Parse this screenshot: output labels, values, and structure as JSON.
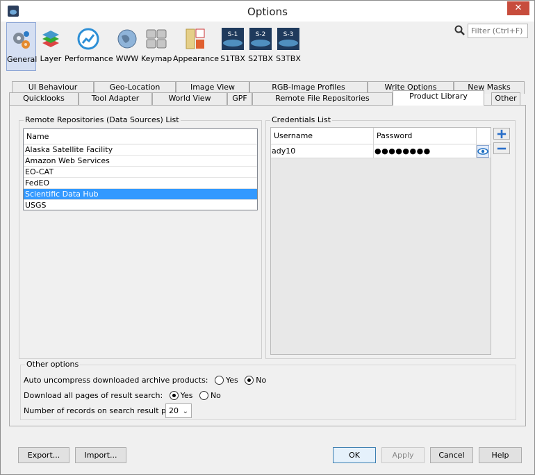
{
  "window": {
    "title": "Options",
    "close_glyph": "✕"
  },
  "toolbar": {
    "items": [
      {
        "label": "General",
        "icon": "gears-icon"
      },
      {
        "label": "Layer",
        "icon": "layers-icon"
      },
      {
        "label": "Performance",
        "icon": "performance-icon"
      },
      {
        "label": "WWW",
        "icon": "globe-icon"
      },
      {
        "label": "Keymap",
        "icon": "keyboard-icon"
      },
      {
        "label": "Appearance",
        "icon": "appearance-icon"
      },
      {
        "label": "S1TBX",
        "icon": "s1-icon",
        "badge": "S-1"
      },
      {
        "label": "S2TBX",
        "icon": "s2-icon",
        "badge": "S-2"
      },
      {
        "label": "S3TBX",
        "icon": "s3-icon",
        "badge": "S-3"
      }
    ],
    "active": "General"
  },
  "search": {
    "placeholder": "Filter (Ctrl+F)"
  },
  "tabs": {
    "row1": [
      "UI Behaviour",
      "Geo-Location",
      "Image View",
      "RGB-Image Profiles",
      "Write Options",
      "New Masks"
    ],
    "row2": [
      "Quicklooks",
      "Tool Adapter",
      "World View",
      "GPF",
      "Remote File Repositories",
      "Product Library",
      "Other"
    ],
    "selected": "Product Library"
  },
  "repositories": {
    "group_title": "Remote Repositories (Data Sources) List",
    "column": "Name",
    "rows": [
      "Alaska Satellite Facility",
      "Amazon Web Services",
      "EO-CAT",
      "FedEO",
      "Scientific Data Hub",
      "USGS"
    ],
    "selected": "Scientific Data Hub"
  },
  "credentials": {
    "group_title": "Credentials List",
    "columns": [
      "Username",
      "Password"
    ],
    "rows": [
      {
        "username": "ady10",
        "password": "●●●●●●●●"
      }
    ],
    "add_glyph": "+",
    "remove_glyph": "−"
  },
  "other_options": {
    "group_title": "Other options",
    "auto_uncompress": {
      "label": "Auto uncompress downloaded archive products:",
      "yes": "Yes",
      "no": "No",
      "value": "No"
    },
    "download_all": {
      "label": "Download all pages of result search:",
      "yes": "Yes",
      "no": "No",
      "value": "Yes"
    },
    "records": {
      "label": "Number of records on search result page:",
      "value": "20",
      "arrow": "⌄"
    }
  },
  "buttons": {
    "export": "Export...",
    "import": "Import...",
    "ok": "OK",
    "apply": "Apply",
    "cancel": "Cancel",
    "help": "Help"
  },
  "colors": {
    "selection": "#3399ff",
    "close": "#c74c3c",
    "active_tool": "#d5dff2"
  }
}
